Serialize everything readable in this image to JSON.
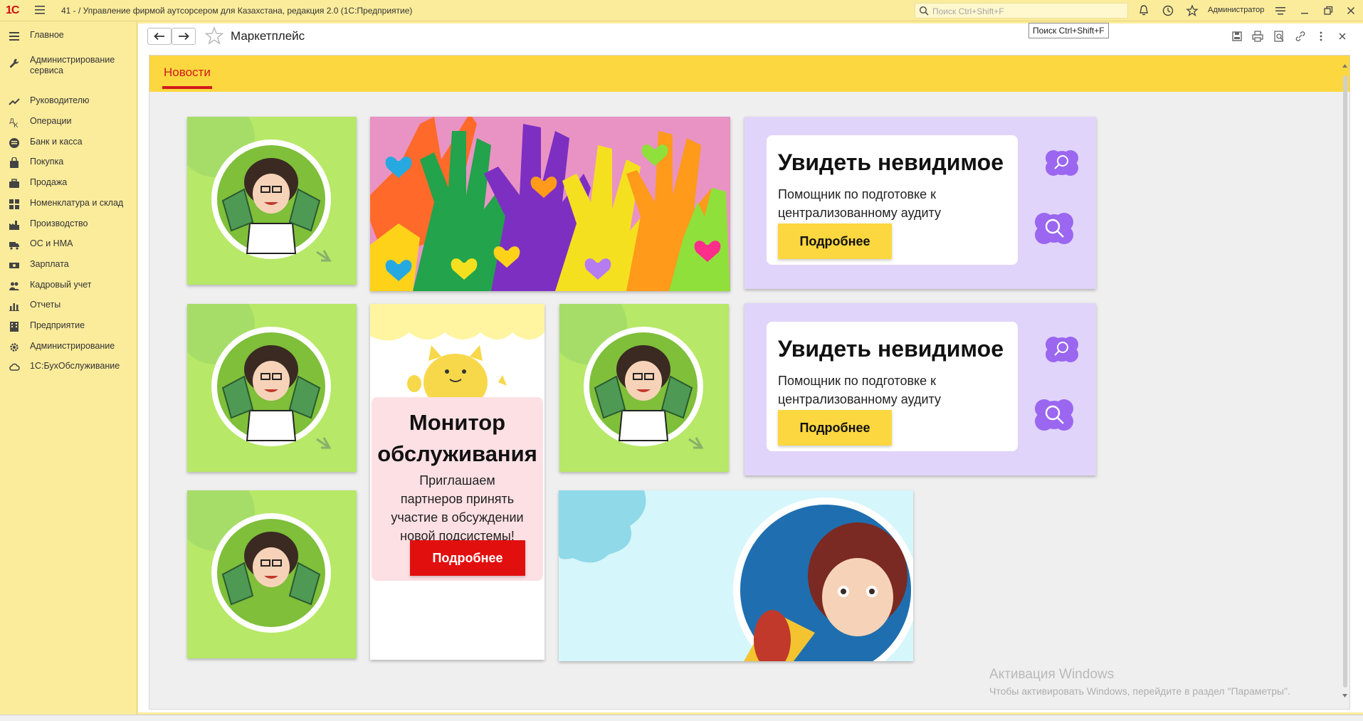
{
  "titlebar": {
    "logo": "1С",
    "title": "41 -  / Управление фирмой аутсорсером для Казахстана, редакция 2.0  (1С:Предприятие)",
    "search_placeholder": "Поиск Ctrl+Shift+F",
    "user": "Администратор",
    "tooltip": "Поиск Ctrl+Shift+F"
  },
  "sidebar": {
    "items": [
      {
        "label": "Главное",
        "icon": "menu-lines-icon"
      },
      {
        "label": "Администрирование сервиса",
        "icon": "wrench-icon"
      },
      {
        "label": "Руководителю",
        "icon": "trend-icon"
      },
      {
        "label": "Операции",
        "icon": "operations-icon"
      },
      {
        "label": "Банк и касса",
        "icon": "coins-icon"
      },
      {
        "label": "Покупка",
        "icon": "bag-icon"
      },
      {
        "label": "Продажа",
        "icon": "briefcase-icon"
      },
      {
        "label": "Номенклатура и склад",
        "icon": "grid-icon"
      },
      {
        "label": "Производство",
        "icon": "factory-icon"
      },
      {
        "label": "ОС и НМА",
        "icon": "truck-icon"
      },
      {
        "label": "Зарплата",
        "icon": "money-icon"
      },
      {
        "label": "Кадровый учет",
        "icon": "people-icon"
      },
      {
        "label": "Отчеты",
        "icon": "bar-chart-icon"
      },
      {
        "label": "Предприятие",
        "icon": "building-icon"
      },
      {
        "label": "Администрирование",
        "icon": "gear-icon"
      },
      {
        "label": "1С:БухОбслуживание",
        "icon": "cloud-icon"
      }
    ]
  },
  "window": {
    "title": "Маркетплейс",
    "tab": "Новости"
  },
  "promo": {
    "title": "Увидеть невидимое",
    "text": "Помощник по подготовке к централизованному аудиту",
    "button": "Подробнее"
  },
  "monitor": {
    "title": "Монитор обслуживания",
    "text": "Приглашаем партнеров принять участие в обсуждении новой подсистемы!",
    "button": "Подробнее"
  },
  "watermark": {
    "line1": "Активация Windows",
    "line2": "Чтобы активировать Windows, перейдите в раздел \"Параметры\"."
  },
  "colors": {
    "accent_yellow": "#fcd73f",
    "accent_red": "#d01a1a",
    "card_green": "#b7e867",
    "card_purple": "#e0d4fb"
  }
}
